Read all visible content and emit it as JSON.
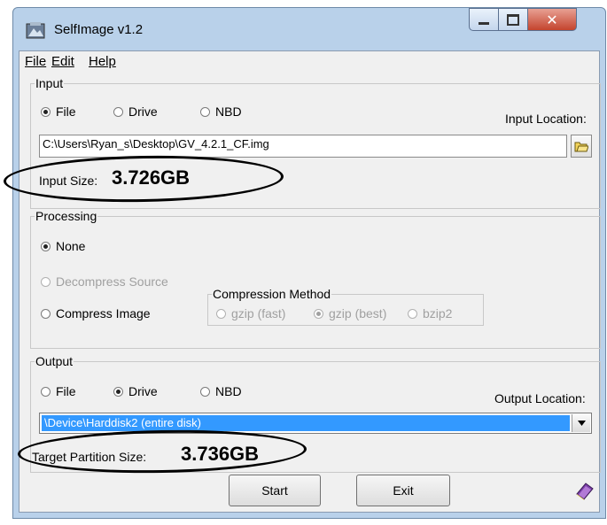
{
  "window": {
    "title": "SelfImage v1.2"
  },
  "menu": {
    "file": "File",
    "edit": "Edit",
    "help": "Help"
  },
  "input": {
    "group_label": "Input",
    "radio_file": "File",
    "radio_drive": "Drive",
    "radio_nbd": "NBD",
    "selected": "File",
    "location_label": "Input Location:",
    "path": "C:\\Users\\Ryan_s\\Desktop\\GV_4.2.1_CF.img",
    "size_label": "Input Size:",
    "size_value": "3.726GB"
  },
  "processing": {
    "group_label": "Processing",
    "none": "None",
    "decompress": "Decompress Source",
    "compress": "Compress Image",
    "selected": "None",
    "compression_label": "Compression Method",
    "gzip_fast": "gzip (fast)",
    "gzip_best": "gzip (best)",
    "bzip2": "bzip2",
    "compression_selected": "gzip (best)"
  },
  "output": {
    "group_label": "Output",
    "radio_file": "File",
    "radio_drive": "Drive",
    "radio_nbd": "NBD",
    "selected": "Drive",
    "location_label": "Output Location:",
    "device": "\\Device\\Harddisk2 (entire disk)",
    "target_label": "Target Partition Size:",
    "target_value": "3.736GB"
  },
  "buttons": {
    "start": "Start",
    "exit": "Exit"
  },
  "colors": {
    "selection": "#3399ff",
    "annotation": "#000000"
  }
}
